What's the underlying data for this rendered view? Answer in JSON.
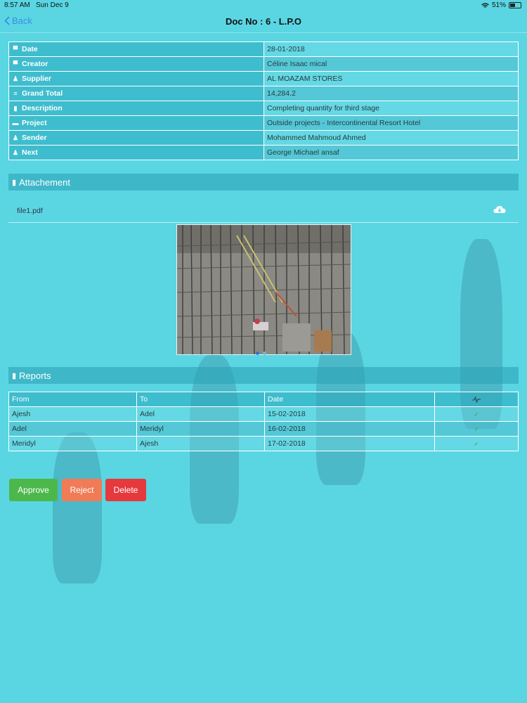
{
  "status": {
    "time": "8:57 AM",
    "date": "Sun Dec 9",
    "battery": "51%"
  },
  "nav": {
    "back_label": "Back",
    "title": "Doc No : 6 - L.P.O"
  },
  "info_rows": [
    {
      "icon": "calendar-icon",
      "label": "Date",
      "value": "28-01-2018"
    },
    {
      "icon": "calendar-icon",
      "label": "Creator",
      "value": "Céline Isaac mical"
    },
    {
      "icon": "user-icon",
      "label": "Supplier",
      "value": "AL MOAZAM STORES"
    },
    {
      "icon": "list-icon",
      "label": "Grand Total",
      "value": "14,284.2"
    },
    {
      "icon": "document-icon",
      "label": "Description",
      "value": "Completing quantity for third stage"
    },
    {
      "icon": "folder-icon",
      "label": "Project",
      "value": "Outside projects - Intercontinental Resort Hotel"
    },
    {
      "icon": "user-icon",
      "label": "Sender",
      "value": "Mohammed Mahmoud Ahmed"
    },
    {
      "icon": "user-icon",
      "label": "Next",
      "value": "George Michael ansaf"
    }
  ],
  "attachment": {
    "title": "Attachement",
    "file_name": "file1.pdf",
    "download_icon": "cloud-download-icon"
  },
  "reports": {
    "title": "Reports",
    "headers": [
      "From",
      "To",
      "Date"
    ],
    "status_icon": "activity-icon",
    "rows": [
      {
        "from": "Ajesh",
        "to": "Adel",
        "date": "15-02-2018"
      },
      {
        "from": "Adel",
        "to": "Meridyl",
        "date": "16-02-2018"
      },
      {
        "from": "Meridyl",
        "to": "Ajesh",
        "date": "17-02-2018"
      }
    ]
  },
  "actions": {
    "approve": "Approve",
    "reject": "Reject",
    "delete": "Delete"
  },
  "colors": {
    "background": "#5ad6e3",
    "approve": "#4cb84c",
    "reject": "#f07b56",
    "delete": "#e5393d",
    "back": "#3b8ce8"
  }
}
